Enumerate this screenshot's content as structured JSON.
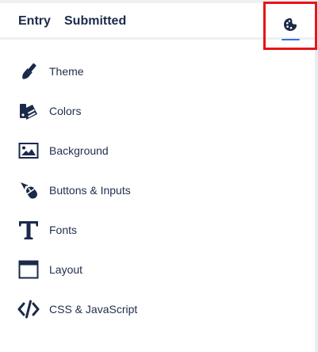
{
  "tabs": [
    {
      "label": "Entry"
    },
    {
      "label": "Submitted"
    }
  ],
  "menu": {
    "items": [
      {
        "label": "Theme",
        "icon": "paintbrush-icon"
      },
      {
        "label": "Colors",
        "icon": "swatches-icon"
      },
      {
        "label": "Background",
        "icon": "image-icon"
      },
      {
        "label": "Buttons & Inputs",
        "icon": "mouse-icon"
      },
      {
        "label": "Fonts",
        "icon": "text-t-icon"
      },
      {
        "label": "Layout",
        "icon": "browser-window-icon"
      },
      {
        "label": "CSS & JavaScript",
        "icon": "code-icon"
      }
    ]
  },
  "colors": {
    "icon": "#1b2a4a",
    "active_underline": "#2f6fe4",
    "highlight": "#e8141a"
  }
}
